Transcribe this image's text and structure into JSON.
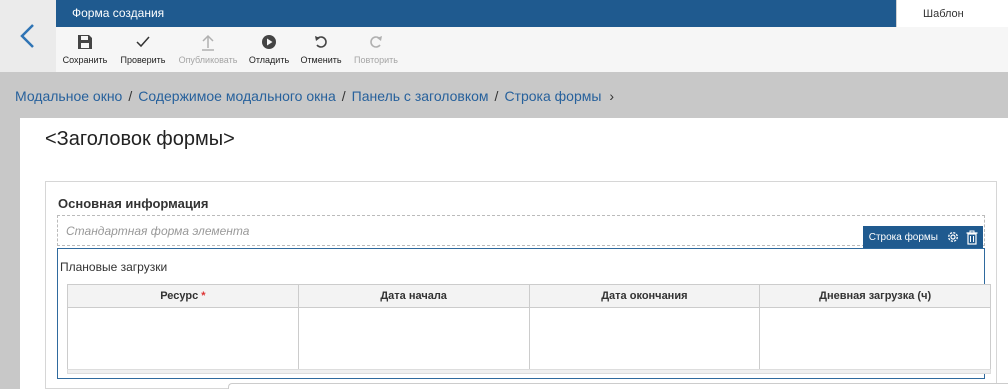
{
  "topbar": {
    "title": "Форма создания",
    "template_tab": "Шаблон"
  },
  "toolbar": {
    "save": "Сохранить",
    "check": "Проверить",
    "publish": "Опубликовать",
    "debug": "Отладить",
    "undo": "Отменить",
    "redo": "Повторить"
  },
  "breadcrumb": [
    "Модальное окно",
    "Содержимое модального окна",
    "Панель с заголовком",
    "Строка формы"
  ],
  "form": {
    "title": "<Заголовок формы>",
    "panel_title": "Основная информация",
    "std_row_text": "Стандартная форма элемента",
    "row_badge": "Строка формы",
    "planned_label": "Плановые загрузки",
    "columns": [
      "Ресурс",
      "Дата начала",
      "Дата окончания",
      "Дневная загрузка (ч)"
    ],
    "required_mark": "*"
  },
  "colors": {
    "topbar": "#1f5a8f",
    "link": "#27619c",
    "required": "#dd3333"
  },
  "icons": [
    "chevron-left-icon",
    "save-icon",
    "check-icon",
    "upload-icon",
    "play-circle-icon",
    "undo-icon",
    "redo-icon",
    "gear-icon",
    "trash-icon",
    "chevron-right-icon"
  ]
}
